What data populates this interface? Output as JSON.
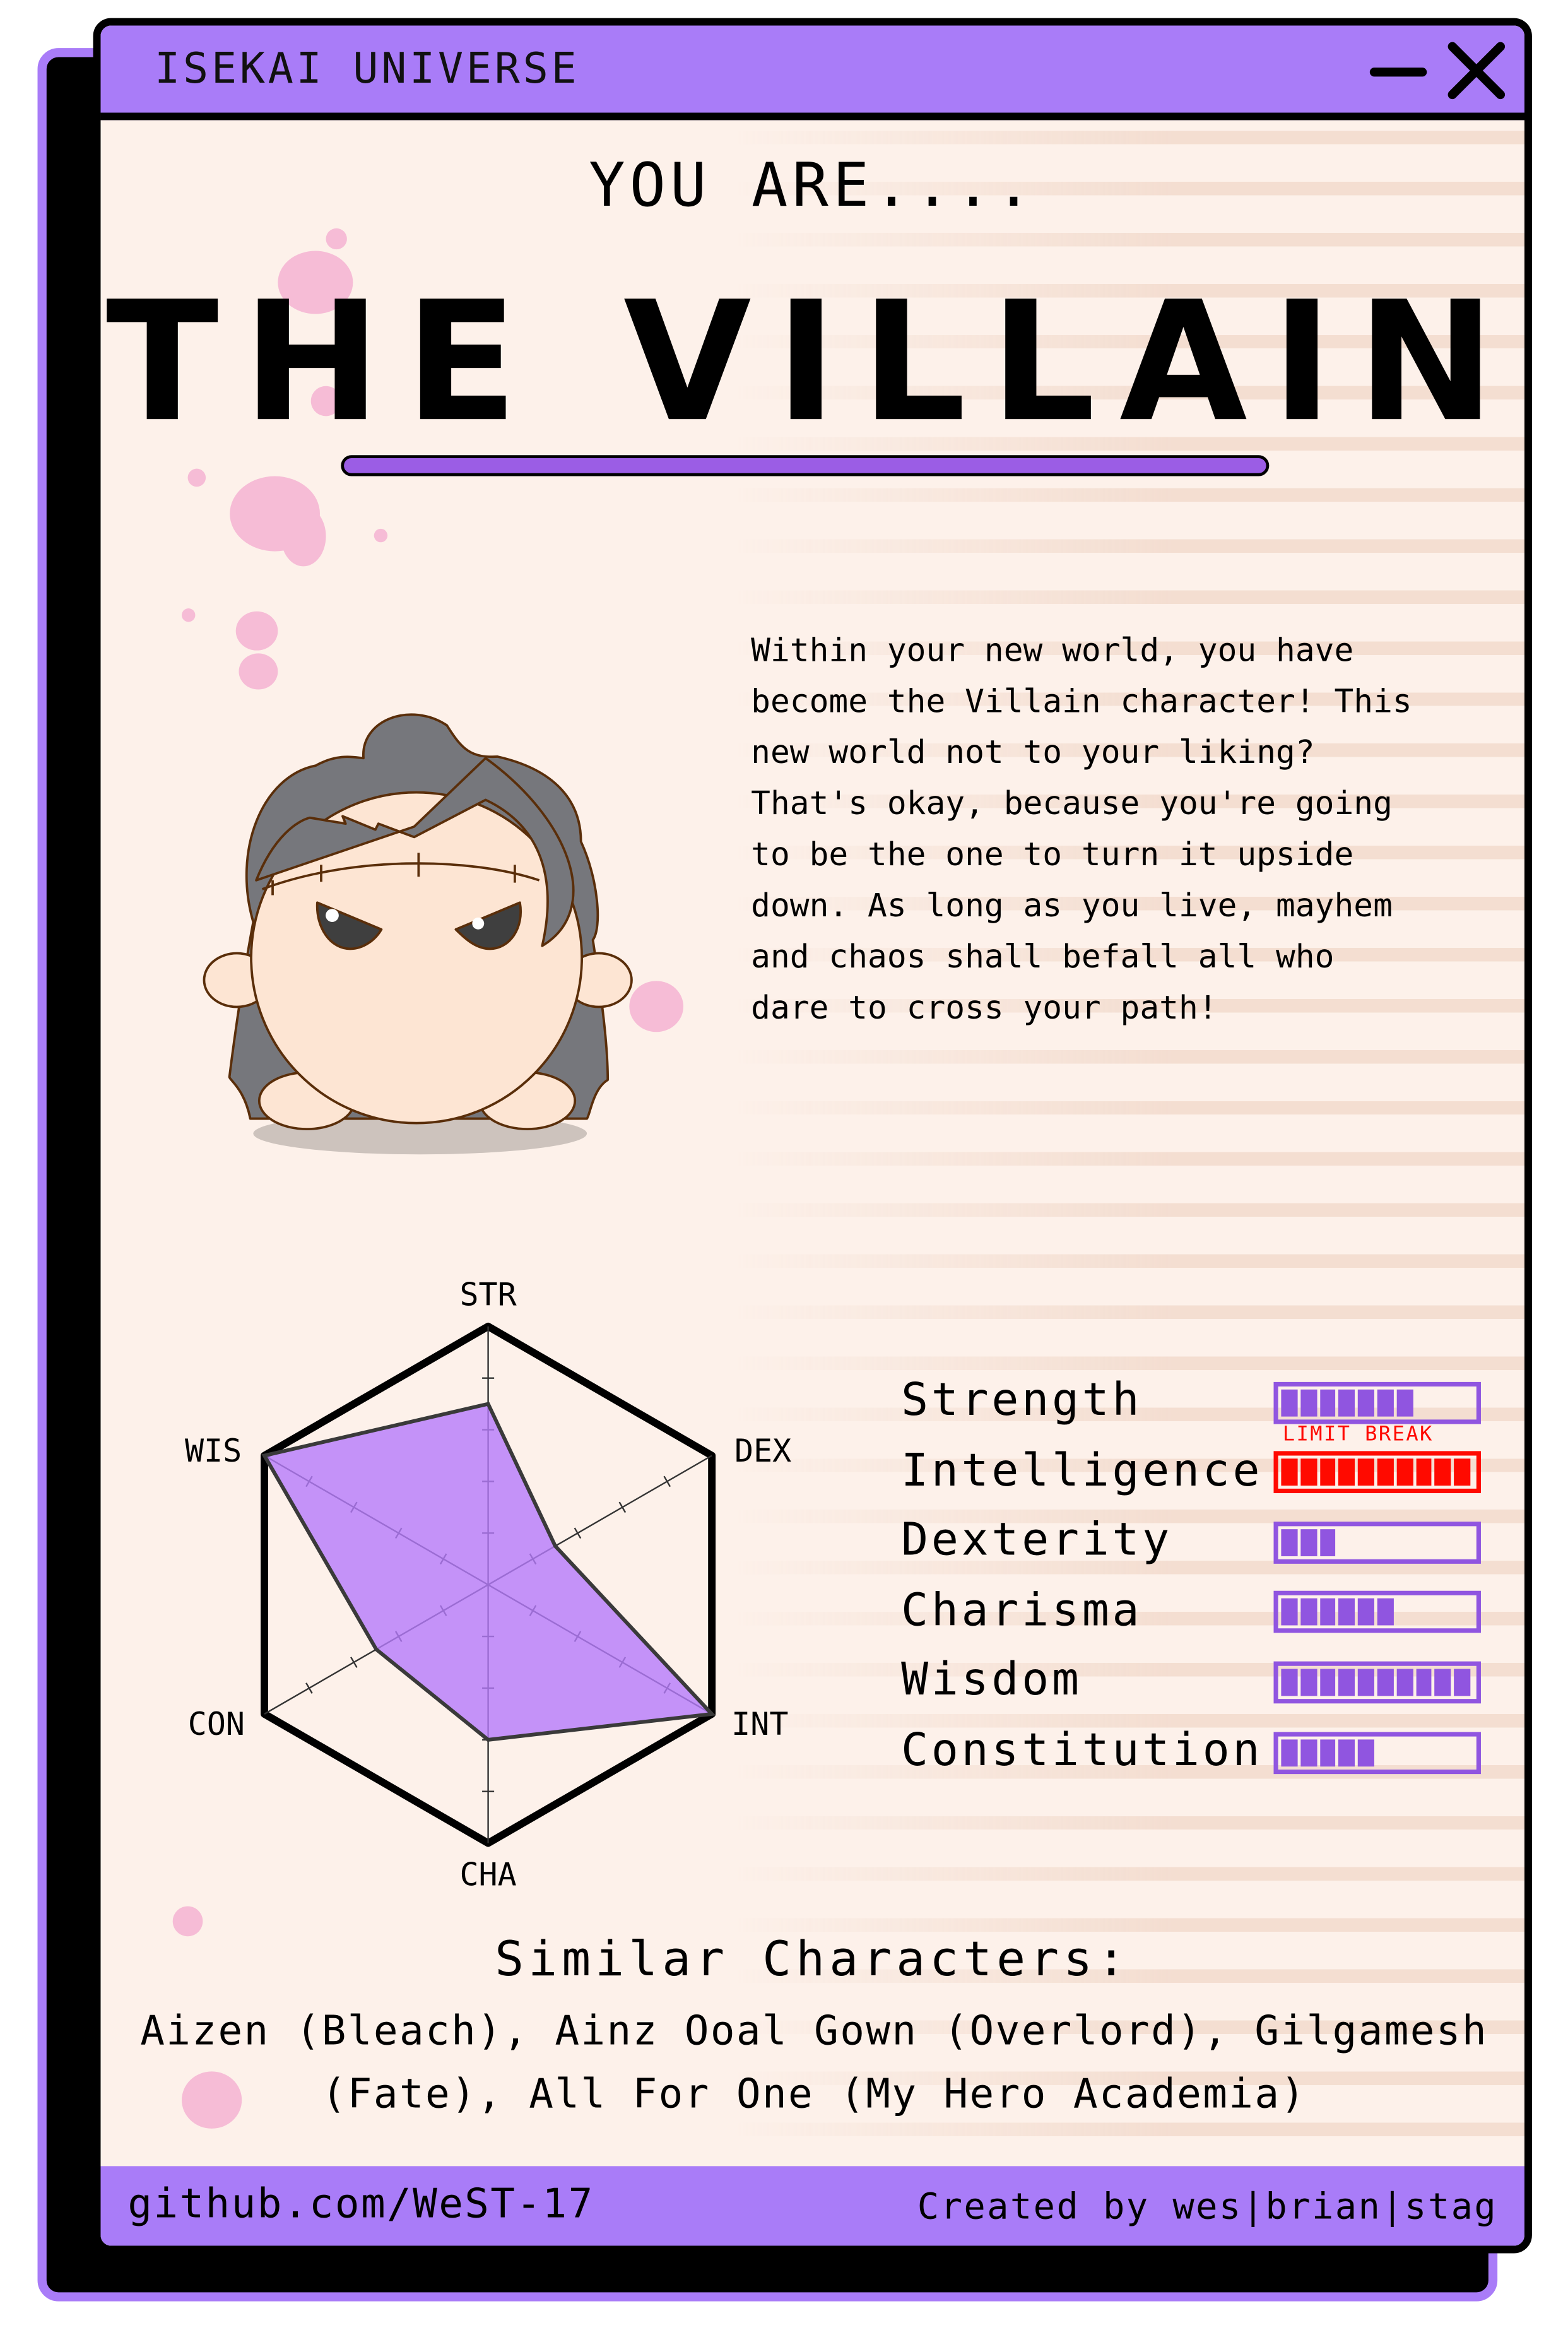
{
  "window": {
    "title": "ISEKAI UNIVERSE",
    "minimize_icon": "minimize-icon",
    "close_icon": "close-icon"
  },
  "result": {
    "intro": "YOU ARE....",
    "role": "THE VILLAIN",
    "description": "Within your new world, you have\nbecome the Villain character! This\nnew world not to your liking?\nThat's okay, because you're going\nto be the one to turn it upside\ndown. As long as you live, mayhem\nand chaos shall befall all who\ndare to cross your path!"
  },
  "colors": {
    "accent": "#a97cf8",
    "bar": "#9055e0",
    "limit_break": "#ff0a00",
    "background": "#fdf1ea",
    "radar_fill": "#c192fc"
  },
  "stats": [
    {
      "abbr": "STR",
      "label": "Strength",
      "value": 7,
      "max": 10,
      "limit_break": false
    },
    {
      "abbr": "INT",
      "label": "Intelligence",
      "value": 10,
      "max": 10,
      "limit_break": true
    },
    {
      "abbr": "DEX",
      "label": "Dexterity",
      "value": 3,
      "max": 10,
      "limit_break": false
    },
    {
      "abbr": "CHA",
      "label": "Charisma",
      "value": 6,
      "max": 10,
      "limit_break": false
    },
    {
      "abbr": "WIS",
      "label": "Wisdom",
      "value": 10,
      "max": 10,
      "limit_break": false
    },
    {
      "abbr": "CON",
      "label": "Constitution",
      "value": 5,
      "max": 10,
      "limit_break": false
    }
  ],
  "limit_break_label": "LIMIT BREAK",
  "chart_data": {
    "type": "radar",
    "axes": [
      "STR",
      "DEX",
      "INT",
      "CHA",
      "CON",
      "WIS"
    ],
    "values": [
      7,
      3,
      10,
      6,
      5,
      10
    ],
    "range": [
      0,
      10
    ]
  },
  "similar": {
    "title": "Similar Characters:",
    "text": "Aizen (Bleach), Ainz Ooal Gown (Overlord), Gilgamesh (Fate), All For One (My Hero Academia)"
  },
  "footer": {
    "link": "github.com/WeST-17",
    "credit": "Created by wes|brian|stag"
  }
}
